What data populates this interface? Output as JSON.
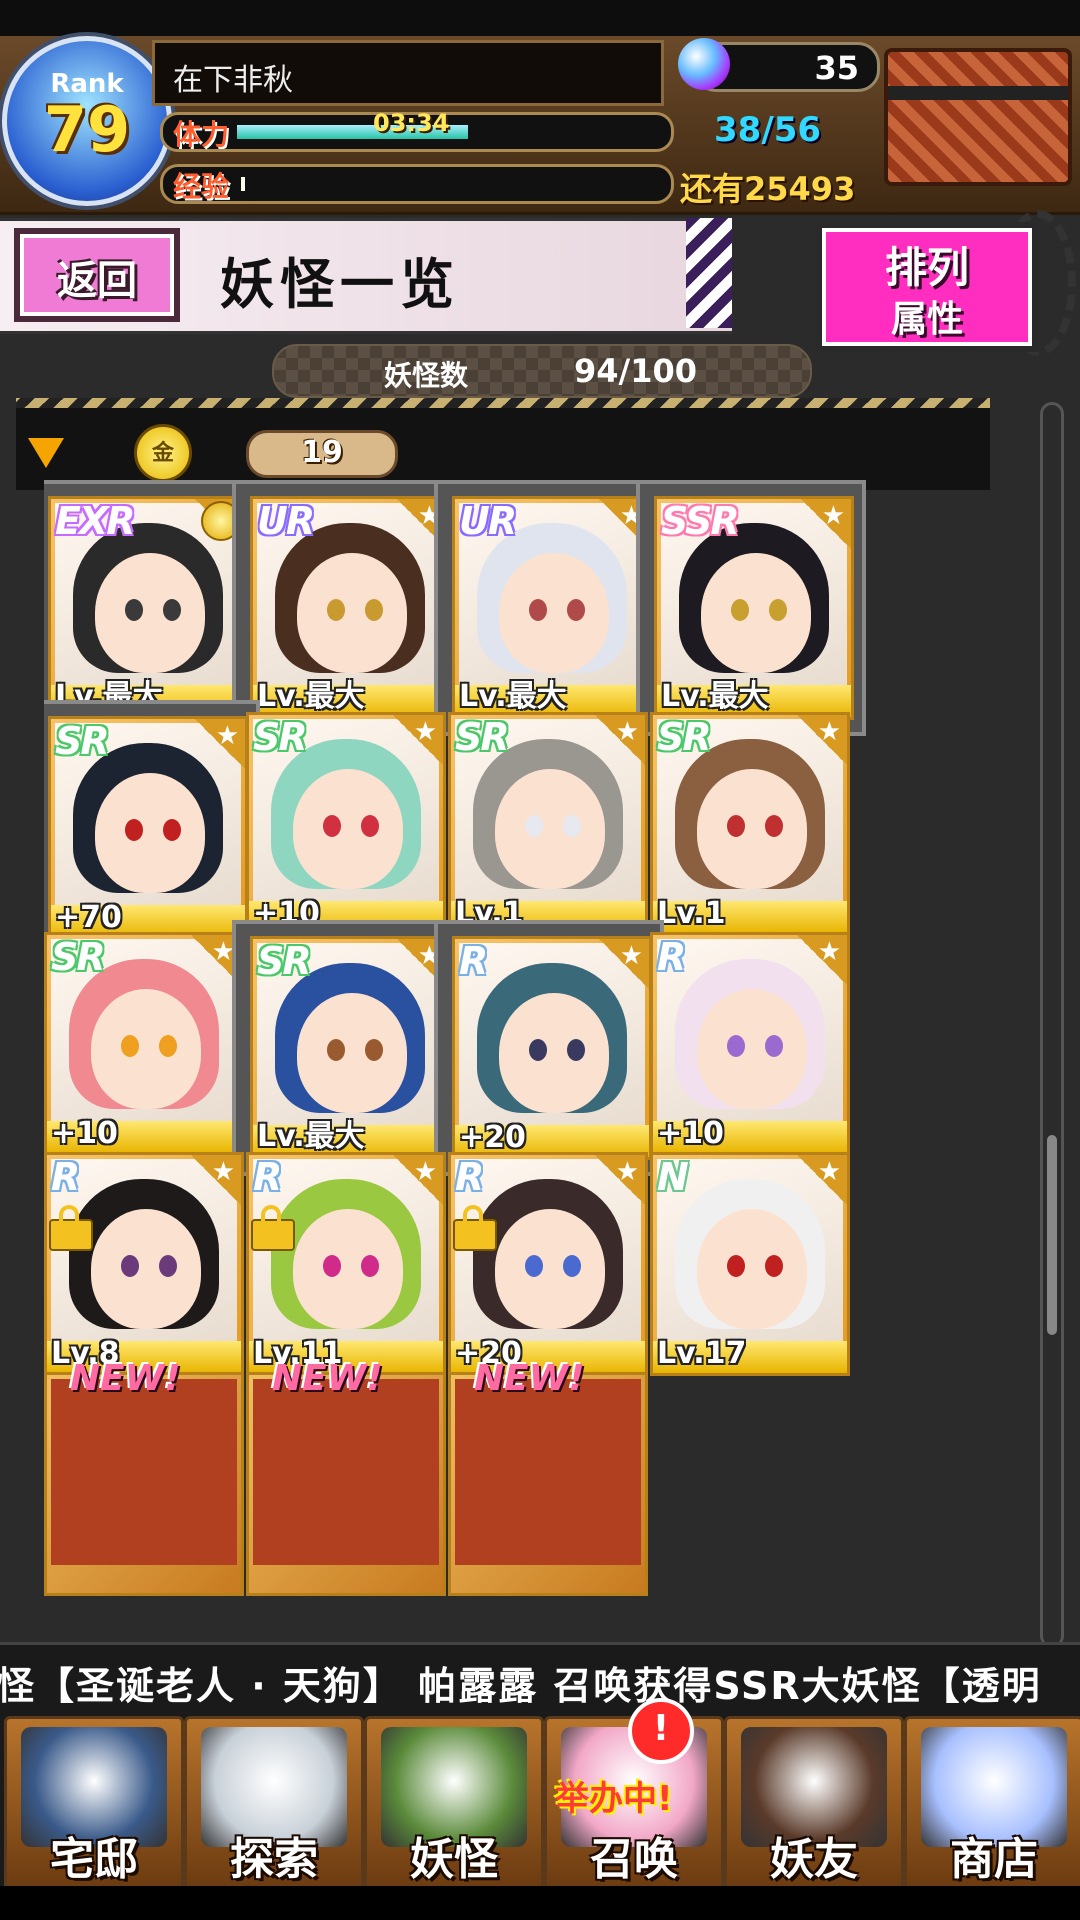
{
  "player": {
    "rank_label": "Rank",
    "rank_value": "79",
    "name": "在下非秋",
    "stamina_label": "体力",
    "stamina_timer": "03:34",
    "stamina_count": "38/56",
    "stamina_fill": 0.55,
    "exp_label": "经验",
    "exp_fill": 0.01,
    "exp_remaining": "还有25493",
    "gems": "35"
  },
  "header": {
    "back_label": "返回",
    "title": "妖怪一览",
    "sort_label": "排列",
    "sort_value": "属性"
  },
  "count": {
    "label": "妖怪数",
    "value": "94/100"
  },
  "filter": {
    "medal_glyph": "金",
    "count": "19"
  },
  "cards": [
    {
      "rarity": "EXR",
      "level": "Lv.最大",
      "selected": true,
      "medal": true,
      "locked": false,
      "hair": "#2a2a2a",
      "eye": "#3a3a3a",
      "rarity_color": "#c56bff"
    },
    {
      "rarity": "UR",
      "level": "Lv.最大",
      "selected": true,
      "medal": false,
      "locked": false,
      "hair": "#4a2f20",
      "eye": "#c89a30",
      "rarity_color": "#8a6bff"
    },
    {
      "rarity": "UR",
      "level": "Lv.最大",
      "selected": true,
      "medal": false,
      "locked": false,
      "hair": "#dfe4ee",
      "eye": "#b04a4a",
      "rarity_color": "#8a6bff"
    },
    {
      "rarity": "SSR",
      "level": "Lv.最大",
      "selected": true,
      "medal": false,
      "locked": false,
      "hair": "#1e1a22",
      "eye": "#c8a030",
      "rarity_color": "#ff7ab0"
    },
    {
      "rarity": "SR",
      "level": "+70",
      "selected": true,
      "medal": false,
      "locked": false,
      "hair": "#1c2432",
      "eye": "#c02020",
      "rarity_color": "#4ac86a"
    },
    {
      "rarity": "SR",
      "level": "+10",
      "selected": false,
      "medal": false,
      "locked": false,
      "hair": "#8fd6c0",
      "eye": "#d03040",
      "rarity_color": "#4ac86a"
    },
    {
      "rarity": "SR",
      "level": "Lv.1",
      "selected": false,
      "medal": false,
      "locked": false,
      "hair": "#9a9690",
      "eye": "#e8e8f0",
      "rarity_color": "#4ac86a"
    },
    {
      "rarity": "SR",
      "level": "Lv.1",
      "selected": false,
      "medal": false,
      "locked": false,
      "hair": "#8a6040",
      "eye": "#c03030",
      "rarity_color": "#4ac86a"
    },
    {
      "rarity": "SR",
      "level": "+10",
      "selected": false,
      "medal": false,
      "locked": false,
      "hair": "#f08a90",
      "eye": "#f0a020",
      "rarity_color": "#4ac86a"
    },
    {
      "rarity": "SR",
      "level": "Lv.最大",
      "selected": true,
      "medal": false,
      "locked": false,
      "hair": "#2a50a0",
      "eye": "#9a5a30",
      "rarity_color": "#4ac86a"
    },
    {
      "rarity": "R",
      "level": "+20",
      "selected": true,
      "medal": false,
      "locked": false,
      "hair": "#3a6a7a",
      "eye": "#3a3a60",
      "rarity_color": "#7ab0e8"
    },
    {
      "rarity": "R",
      "level": "+10",
      "selected": false,
      "medal": false,
      "locked": false,
      "hair": "#f2e0ee",
      "eye": "#9a6ad0",
      "rarity_color": "#7ab0e8"
    },
    {
      "rarity": "R",
      "level": "Lv.8",
      "selected": false,
      "medal": false,
      "locked": true,
      "hair": "#1e1a1a",
      "eye": "#6a3a7a",
      "rarity_color": "#7ab0e8"
    },
    {
      "rarity": "R",
      "level": "Lv.11",
      "selected": false,
      "medal": false,
      "locked": true,
      "hair": "#9ac840",
      "eye": "#d02a8a",
      "rarity_color": "#7ab0e8"
    },
    {
      "rarity": "R",
      "level": "+20",
      "selected": false,
      "medal": false,
      "locked": true,
      "hair": "#3a2a2a",
      "eye": "#4a6ad0",
      "rarity_color": "#7ab0e8"
    },
    {
      "rarity": "N",
      "level": "Lv.17",
      "selected": false,
      "medal": false,
      "locked": false,
      "hair": "#f0f0f0",
      "eye": "#c02020",
      "rarity_color": "#6ac890"
    }
  ],
  "new_cards": [
    {
      "badge": "NEW!"
    },
    {
      "badge": "NEW!"
    },
    {
      "badge": "NEW!"
    }
  ],
  "ticker": {
    "text": "怪【圣诞老人 · 天狗】    帕露露 召唤获得SSR大妖怪【透明"
  },
  "nav": {
    "items": [
      {
        "label": "宅邸",
        "color": "#3a5a8a"
      },
      {
        "label": "探索",
        "color": "#c8d0d8"
      },
      {
        "label": "妖怪",
        "color": "#5a8a3a"
      },
      {
        "label": "召唤",
        "color": "#f2a8c8"
      },
      {
        "label": "妖友",
        "color": "#5a3a2a"
      },
      {
        "label": "商店",
        "color": "#a8c0ff"
      }
    ],
    "summon_badge": "举办中!",
    "alert_glyph": "!"
  }
}
